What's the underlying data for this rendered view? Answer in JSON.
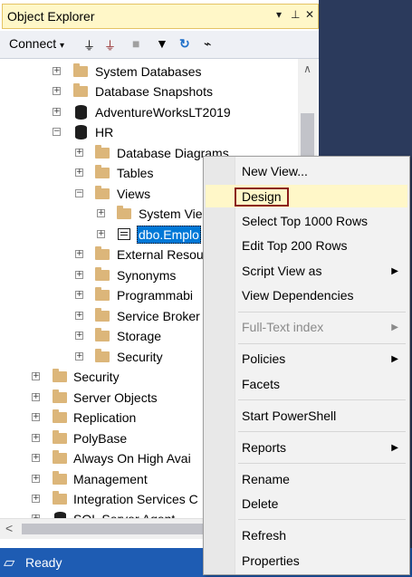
{
  "panel": {
    "title": "Object Explorer",
    "title_controls": [
      "▾",
      "ᚋ",
      "✕"
    ]
  },
  "toolbar": {
    "connect_label": "Connect",
    "connect_arrow": "▾"
  },
  "tree": {
    "system_databases": "System Databases",
    "database_snapshots": "Database Snapshots",
    "adventureworks": "AdventureWorksLT2019",
    "hr": "HR",
    "database_diagrams": "Database Diagrams",
    "tables": "Tables",
    "views": "Views",
    "system_views": "System Vie",
    "dbo_employee": "dbo.Emplo",
    "external_resources": "External Resou",
    "synonyms": "Synonyms",
    "programmability": "Programmabi",
    "service_broker": "Service Broker",
    "storage": "Storage",
    "hr_security": "Security",
    "security": "Security",
    "server_objects": "Server Objects",
    "replication": "Replication",
    "polybase": "PolyBase",
    "always_on": "Always On High Avai",
    "management": "Management",
    "integration_services": "Integration Services C",
    "sql_server_agent": "SQL Server Agent"
  },
  "status": {
    "text": "Ready"
  },
  "context_menu": {
    "new_view": "New View...",
    "design": "Design",
    "select_top": "Select Top 1000 Rows",
    "edit_top": "Edit Top 200 Rows",
    "script_view_as": "Script View as",
    "view_dependencies": "View Dependencies",
    "full_text_index": "Full-Text index",
    "policies": "Policies",
    "facets": "Facets",
    "start_powershell": "Start PowerShell",
    "reports": "Reports",
    "rename": "Rename",
    "delete": "Delete",
    "refresh": "Refresh",
    "properties": "Properties",
    "submenu_arrow": "▶"
  }
}
